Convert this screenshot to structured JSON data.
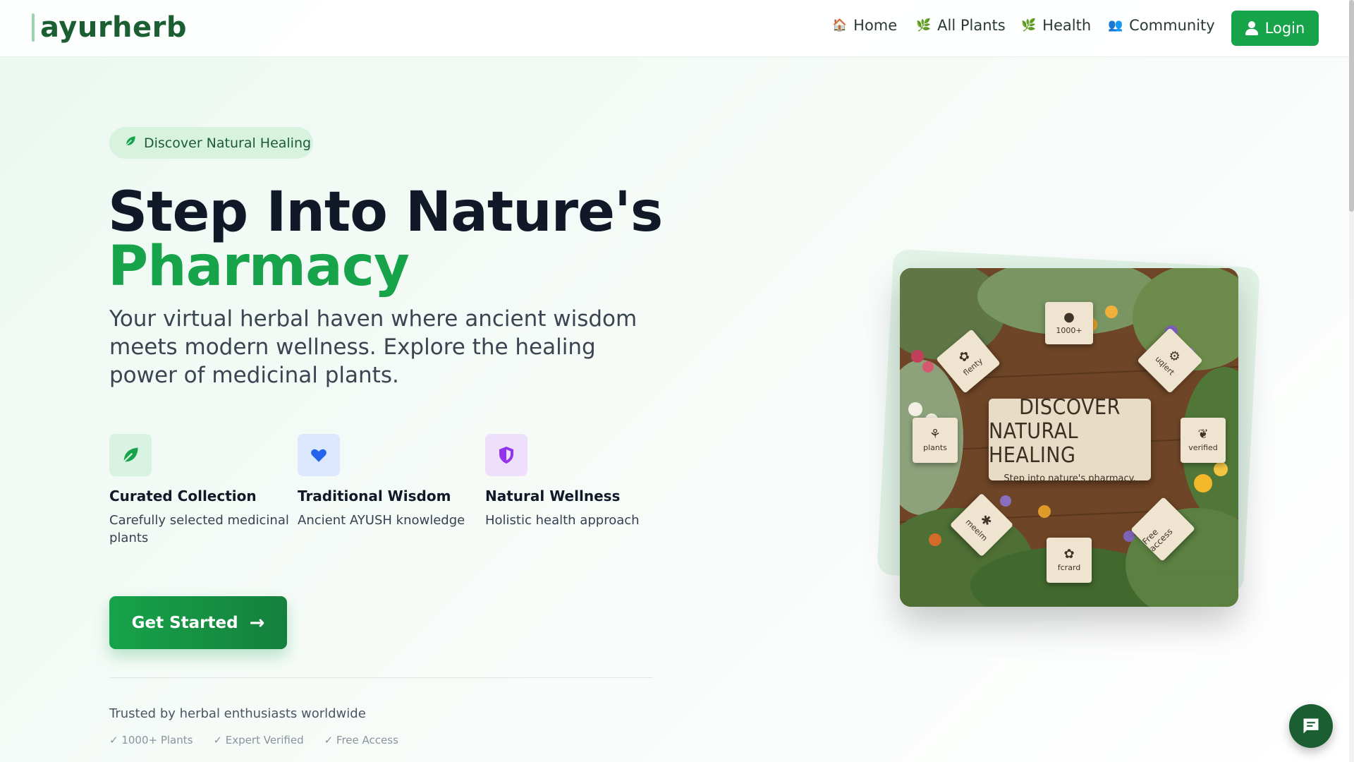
{
  "brand": {
    "name": "ayurherb"
  },
  "nav": {
    "items": [
      {
        "label": "Home",
        "icon": "house-icon"
      },
      {
        "label": "All Plants",
        "icon": "herb-icon"
      },
      {
        "label": "Health",
        "icon": "herb-icon"
      },
      {
        "label": "Community",
        "icon": "people-icon"
      }
    ],
    "login_label": "Login"
  },
  "hero": {
    "badge": "Discover Natural Healing",
    "title_line1": "Step Into Nature's",
    "title_line2": "Pharmacy",
    "subtitle": "Your virtual herbal haven where ancient wisdom meets modern wellness. Explore the healing power of medicinal plants.",
    "features": [
      {
        "title": "Curated Collection",
        "desc": "Carefully selected medicinal plants",
        "icon": "leaf-icon",
        "color": "#16a34a",
        "bg": "#d8f3e1"
      },
      {
        "title": "Traditional Wisdom",
        "desc": "Ancient AYUSH knowledge",
        "icon": "heart-icon",
        "color": "#2563eb",
        "bg": "#dbe8fd"
      },
      {
        "title": "Natural Wellness",
        "desc": "Holistic health approach",
        "icon": "shield-icon",
        "color": "#9333ea",
        "bg": "#eee0fc"
      }
    ],
    "cta_label": "Get Started",
    "trusted_text": "Trusted by herbal enthusiasts worldwide",
    "checks": [
      "✓ 1000+ Plants",
      "✓ Expert Verified",
      "✓ Free Access"
    ]
  },
  "image_card": {
    "sign_line1": "DISCOVER",
    "sign_line2": "NATURAL HEALING",
    "sign_line3": "Step into nature's pharmacy.",
    "tags": [
      "1000+",
      "flenty",
      "uqlert",
      "plants",
      "verified",
      "meelm",
      "Free access",
      "fcrard"
    ]
  },
  "colors": {
    "accent": "#16a34a",
    "brand_dark": "#1b5e32"
  }
}
